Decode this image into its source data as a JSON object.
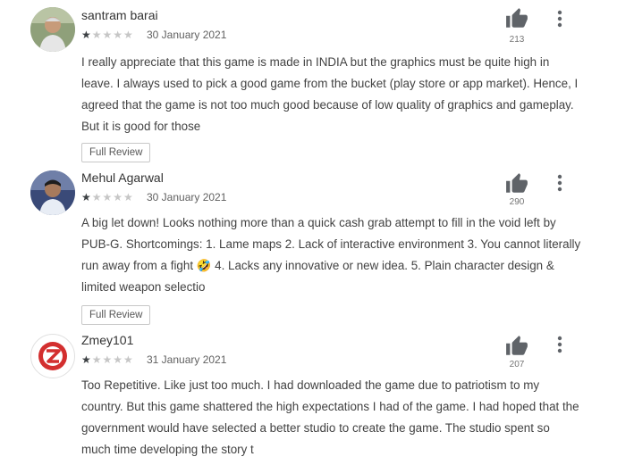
{
  "reviews": [
    {
      "name": "santram barai",
      "stars": "★",
      "stars_off": "★★★★",
      "rating": 1,
      "date": "30 January 2021",
      "likes": "213",
      "text": "I really appreciate that this game is made in INDIA but the graphics must be quite high in leave. I always used to pick a good game from the bucket (play store or app market). Hence, I agreed that the game is not too much good because of low quality of graphics and gameplay. But it is good for those",
      "button": "Full Review"
    },
    {
      "name": "Mehul Agarwal",
      "stars": "★",
      "stars_off": "★★★★",
      "rating": 1,
      "date": "30 January 2021",
      "likes": "290",
      "text": "A big let down! Looks nothing more than a quick cash grab attempt to fill in the void left by PUB-G. Shortcomings: 1. Lame maps 2. Lack of interactive environment 3. You cannot literally run away from a fight 🤣 4. Lacks any innovative or new idea. 5. Plain character design & limited weapon selectio",
      "button": "Full Review"
    },
    {
      "name": "Zmey101",
      "stars": "★",
      "stars_off": "★★★★",
      "rating": 1,
      "date": "31 January 2021",
      "likes": "207",
      "text": "Too Repetitive. Like just too much. I had downloaded the game due to patriotism to my country. But this game shattered the high expectations I had of the game. I had hoped that the government would have selected a better studio to create the game. The studio spent so much time developing the story t"
    }
  ],
  "icons": {
    "like": "thumbs-up-icon",
    "menu": "more-vert-icon"
  },
  "colors": {
    "text": "#424242",
    "meta": "#616161",
    "star_on": "#3c4043",
    "star_off": "#c6c6c6"
  }
}
